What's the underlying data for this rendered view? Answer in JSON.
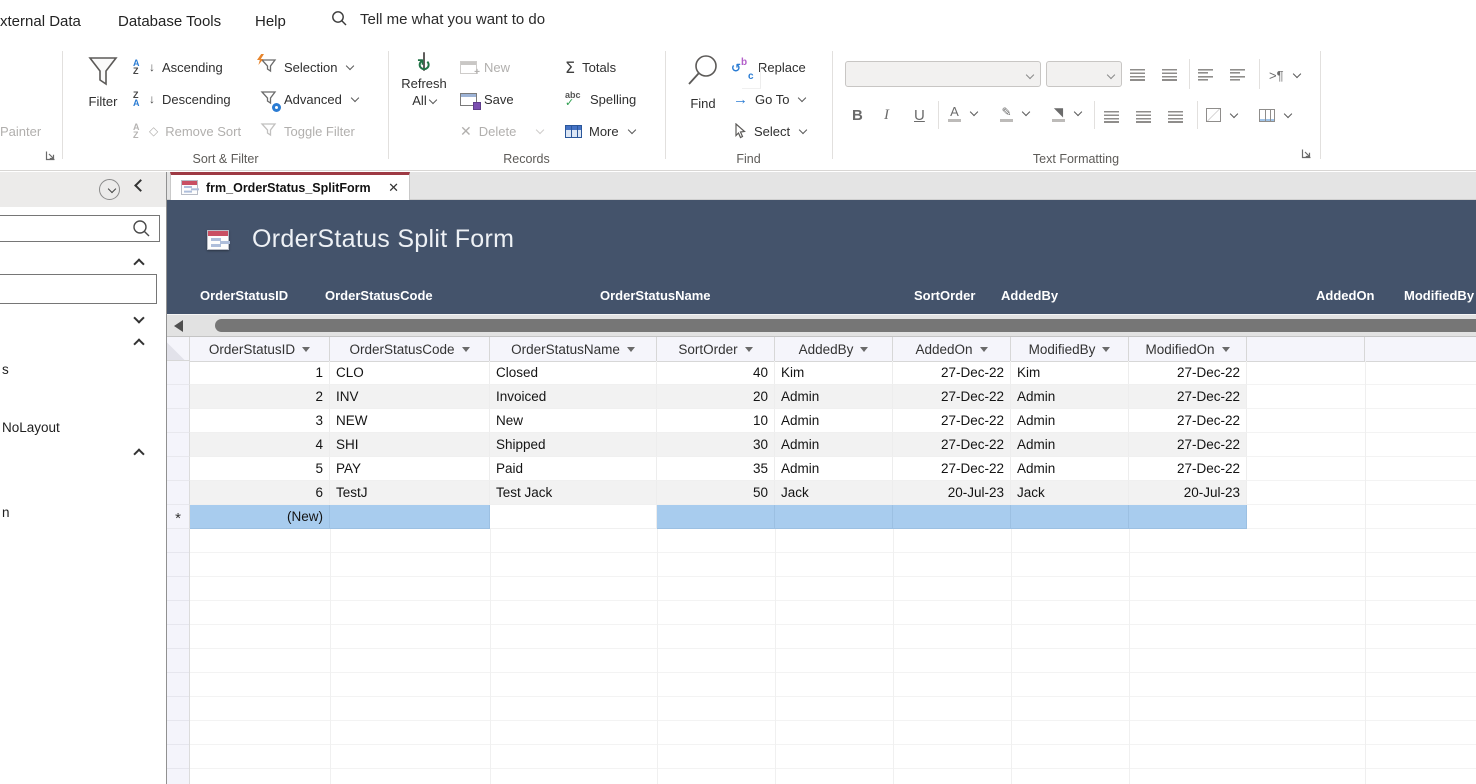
{
  "titlebar": {
    "tabs": [
      {
        "label": "xternal Data"
      },
      {
        "label": "Database Tools"
      },
      {
        "label": "Help"
      }
    ],
    "tell_me": "Tell me what you want to do"
  },
  "ribbon": {
    "clipboard": {
      "painter": "Painter"
    },
    "sort_filter": {
      "title": "Sort & Filter",
      "filter": "Filter",
      "ascending": "Ascending",
      "descending": "Descending",
      "remove_sort": "Remove Sort",
      "selection": "Selection",
      "advanced": "Advanced",
      "toggle_filter": "Toggle Filter"
    },
    "records": {
      "title": "Records",
      "refresh_line1": "Refresh",
      "refresh_line2": "All",
      "new": "New",
      "save": "Save",
      "delete": "Delete",
      "totals": "Totals",
      "spelling": "Spelling",
      "more": "More"
    },
    "find_group": {
      "title": "Find",
      "find": "Find",
      "replace": "Replace",
      "go_to": "Go To",
      "select": "Select"
    },
    "text_formatting": {
      "title": "Text Formatting",
      "bold": "B",
      "italic": "I",
      "underline": "U",
      "direction": ">¶"
    }
  },
  "document_tab": {
    "title": "frm_OrderStatus_SplitForm",
    "close": "✕"
  },
  "form": {
    "title": "OrderStatus Split Form",
    "header_labels": [
      "OrderStatusID",
      "OrderStatusCode",
      "OrderStatusName",
      "SortOrder",
      "AddedBy",
      "AddedOn",
      "ModifiedBy"
    ]
  },
  "datasheet": {
    "columns": [
      "OrderStatusID",
      "OrderStatusCode",
      "OrderStatusName",
      "SortOrder",
      "AddedBy",
      "AddedOn",
      "ModifiedBy",
      "ModifiedOn"
    ],
    "rows": [
      [
        "1",
        "CLO",
        "Closed",
        "40",
        "Kim",
        "27-Dec-22",
        "Kim",
        "27-Dec-22"
      ],
      [
        "2",
        "INV",
        "Invoiced",
        "20",
        "Admin",
        "27-Dec-22",
        "Admin",
        "27-Dec-22"
      ],
      [
        "3",
        "NEW",
        "New",
        "10",
        "Admin",
        "27-Dec-22",
        "Admin",
        "27-Dec-22"
      ],
      [
        "4",
        "SHI",
        "Shipped",
        "30",
        "Admin",
        "27-Dec-22",
        "Admin",
        "27-Dec-22"
      ],
      [
        "5",
        "PAY",
        "Paid",
        "35",
        "Admin",
        "27-Dec-22",
        "Admin",
        "27-Dec-22"
      ],
      [
        "6",
        "TestJ",
        "Test Jack",
        "50",
        "Jack",
        "20-Jul-23",
        "Jack",
        "20-Jul-23"
      ]
    ],
    "new_row": {
      "marker": "*",
      "id_value": "(New)"
    }
  },
  "nav_pane": {
    "partial_items": [
      "s",
      "NoLayout",
      "n"
    ]
  },
  "colors": {
    "accent_red": "#9E3A44",
    "form_header": "#44536B",
    "new_row_highlight": "#A8CCEE",
    "row_stripe": "#F2F2F2"
  }
}
